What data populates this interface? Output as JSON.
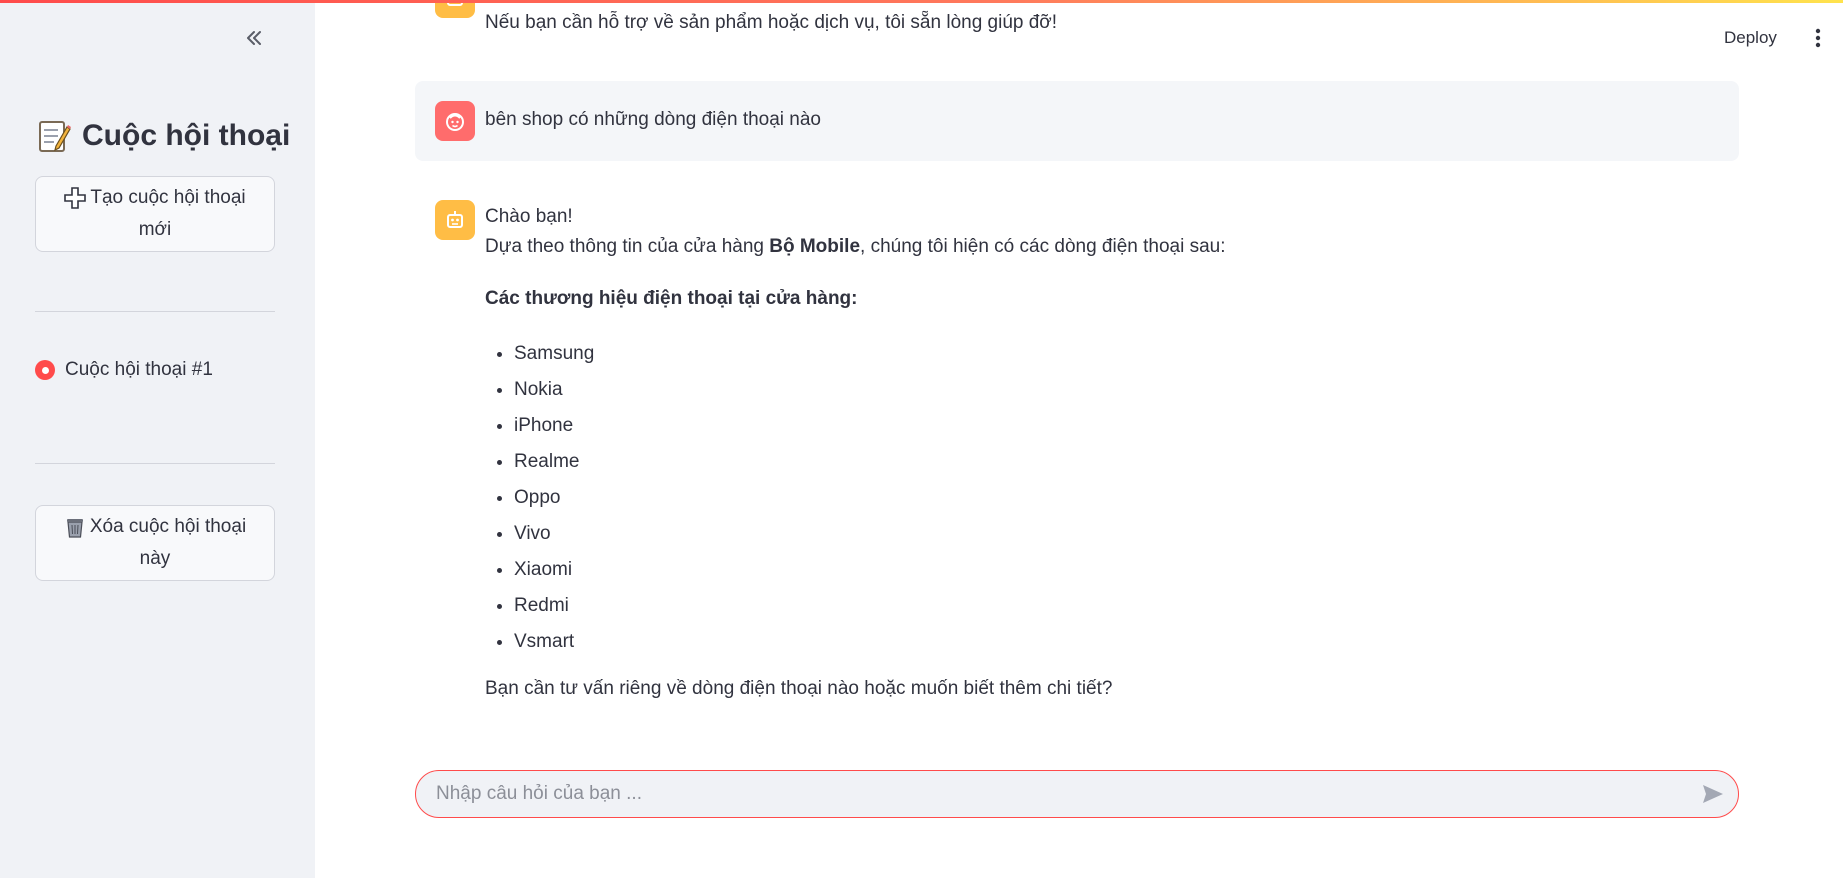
{
  "sidebar": {
    "collapse_icon": "chevrons-left-icon",
    "title_icon": "memo-icon",
    "title": "Cuộc hội thoại",
    "new_chat_icon": "plus-icon",
    "new_chat_line1": "Tạo cuộc hội thoại",
    "new_chat_line2": "mới",
    "conversations": [
      {
        "label": "Cuộc hội thoại #1",
        "selected": true
      }
    ],
    "delete_icon": "trash-can-icon",
    "delete_line1": "Xóa cuộc hội thoại",
    "delete_line2": "này"
  },
  "header": {
    "deploy_label": "Deploy",
    "menu_icon": "vertical-dots-icon"
  },
  "messages": [
    {
      "role": "assistant",
      "avatar_icon": "robot-icon",
      "text": "Nếu bạn cần hỗ trợ về sản phẩm hoặc dịch vụ, tôi sẵn lòng giúp đỡ!"
    },
    {
      "role": "user",
      "avatar_icon": "smiley-face-icon",
      "text": "bên shop có những dòng điện thoại nào"
    },
    {
      "role": "assistant",
      "avatar_icon": "robot-icon",
      "greeting": "Chào bạn!",
      "intro_before": "Dựa theo thông tin của cửa hàng ",
      "intro_bold": "Bộ Mobile",
      "intro_after": ", chúng tôi hiện có các dòng điện thoại sau:",
      "heading": "Các thương hiệu điện thoại tại cửa hàng:",
      "brands": [
        "Samsung",
        "Nokia",
        "iPhone",
        "Realme",
        "Oppo",
        "Vivo",
        "Xiaomi",
        "Redmi",
        "Vsmart"
      ],
      "closing": "Bạn cần tư vấn riêng về dòng điện thoại nào hoặc muốn biết thêm chi tiết?"
    }
  ],
  "chat_input": {
    "placeholder": "Nhập câu hỏi của bạn ...",
    "value": "",
    "send_icon": "send-arrow-icon"
  },
  "colors": {
    "accent": "#ff4b4b",
    "sidebar_bg": "#f0f2f6",
    "bot_avatar": "#ffbd45",
    "user_avatar": "#ff6c6c",
    "text": "#31333f"
  }
}
